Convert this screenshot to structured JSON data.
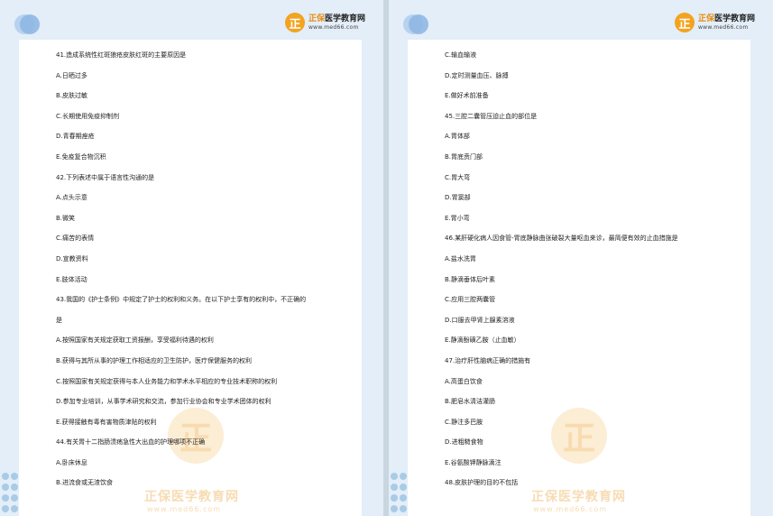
{
  "logo": {
    "mark": "正",
    "name_part1": "正保",
    "name_part2": "医学教育网",
    "url": "www.med66.com"
  },
  "watermark": {
    "mark": "正",
    "text": "正保医学教育网",
    "url": "www.med66.com"
  },
  "pages": [
    {
      "lines": [
        "41.造成系统性红斑狼疮皮肤红斑的主要原因是",
        "A.日晒过多",
        "B.皮肤过敏",
        "C.长期使用免疫抑制剂",
        "D.青春期痤疮",
        "E.免疫复合物沉积",
        "42.下列表述中属于语言性沟通的是",
        "A.点头示意",
        "B.微笑",
        "C.痛苦的表情",
        "D.宣教资料",
        "E.肢体活动",
        "43.我国的《护士条例》中规定了护士的权利和义务。在以下护士享有的权利中，不正确的",
        "是",
        "A.按照国家有关规定获取工资报酬，享受福利待遇的权利",
        "B.获得与其所从事的护理工作相适应的卫生防护，医疗保健服务的权利",
        "C.按照国家有关规定获得与本人业务能力和学术水平相应的专业技术职称的权利",
        "D.参加专业培训，从事学术研究和交流，参加行业协会和专业学术团体的权利",
        "E.获得接触有毒有害物质津贴的权利",
        "44.有关胃十二指肠溃疡急性大出血的护理哪项不正确",
        "A.卧床休息",
        "B.进流食或无渣饮食"
      ]
    },
    {
      "lines": [
        "C.输血输液",
        "D.定时测量血压、脉搏",
        "E.做好术前准备",
        "45.三腔二囊管压迫止血的部位是",
        "A.胃体部",
        "B.胃底贲门部",
        "C.胃大弯",
        "D.胃窦部",
        "E.胃小弯",
        "46.某肝硬化病人因食管-胃底静脉曲张破裂大量呕血来诊，最简便有效的止血措施是",
        "A.盐水洗胃",
        "B.静滴垂体后叶素",
        "C.应用三腔两囊管",
        "D.口服去甲肾上腺素溶液",
        "E.静滴酚磺乙胺（止血敏）",
        "47.治疗肝性脑病正确的措施有",
        "A.高蛋白饮食",
        "B.肥皂水清洁灌肠",
        "C.静注多巴胺",
        "D.进粗糙食物",
        "E.谷氨酸钾静脉滴注",
        "48.皮肤护理的目的不包括"
      ]
    }
  ]
}
